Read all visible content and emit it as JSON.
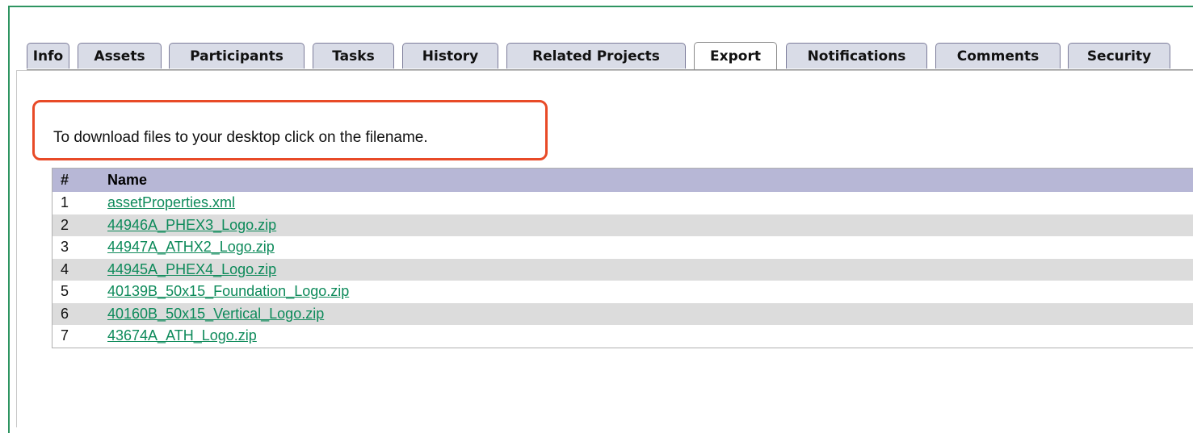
{
  "tabs": [
    {
      "label": "Info",
      "active": false
    },
    {
      "label": "Assets",
      "active": false
    },
    {
      "label": "Participants",
      "active": false
    },
    {
      "label": "Tasks",
      "active": false
    },
    {
      "label": "History",
      "active": false
    },
    {
      "label": "Related Projects",
      "active": false
    },
    {
      "label": "Export",
      "active": true
    },
    {
      "label": "Notifications",
      "active": false
    },
    {
      "label": "Comments",
      "active": false
    },
    {
      "label": "Security",
      "active": false
    }
  ],
  "instructions": "To download files to your desktop click on the filename.",
  "table": {
    "headers": {
      "num": "#",
      "name": "Name"
    },
    "rows": [
      {
        "num": "1",
        "name": "assetProperties.xml"
      },
      {
        "num": "2",
        "name": "44946A_PHEX3_Logo.zip"
      },
      {
        "num": "3",
        "name": "44947A_ATHX2_Logo.zip"
      },
      {
        "num": "4",
        "name": "44945A_PHEX4_Logo.zip"
      },
      {
        "num": "5",
        "name": "40139B_50x15_Foundation_Logo.zip"
      },
      {
        "num": "6",
        "name": "40160B_50x15_Vertical_Logo.zip"
      },
      {
        "num": "7",
        "name": "43674A_ATH_Logo.zip"
      }
    ]
  },
  "colors": {
    "frame": "#2e9461",
    "callout": "#e84a27",
    "header_bg": "#b7b7d6",
    "link": "#0d8a5a"
  }
}
